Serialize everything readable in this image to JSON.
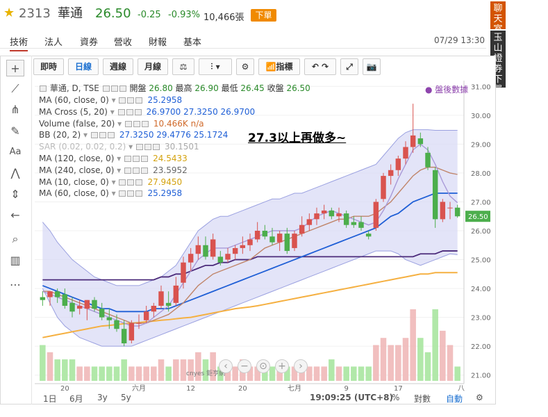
{
  "header": {
    "code": "2313",
    "name": "華通",
    "price": "26.50",
    "change": "-0.25",
    "change_pct": "-0.93%",
    "volume": "10,466張",
    "order_button": "下單"
  },
  "tabs": [
    "技術",
    "法人",
    "資券",
    "營收",
    "財報",
    "基本"
  ],
  "datetime": "07/29 13:30",
  "side_buttons": {
    "chat": "聊天室",
    "broker": "玉山證券下單"
  },
  "toolbar": {
    "periods": [
      "即時",
      "日線",
      "週線",
      "月線"
    ],
    "indicators": "指標"
  },
  "legend": {
    "main": {
      "label": "華通, D, TSE",
      "open_label": "開盤",
      "open": "26.80",
      "high_label": "最高",
      "high": "26.90",
      "low_label": "最低",
      "low": "26.45",
      "close_label": "收盤",
      "close": "26.50"
    },
    "rows": [
      {
        "label": "MA (60, close, 0)",
        "value": "25.2958"
      },
      {
        "label": "MA Cross (5, 20)",
        "value": "26.9700  27.3250  26.9700"
      },
      {
        "label": "Volume (false, 20)",
        "value": "10.466K  n/a"
      },
      {
        "label": "BB (20, 2)",
        "value": "27.3250  29.4776  25.1724"
      },
      {
        "label": "SAR (0.02, 0.02, 0.2)",
        "value": "30.1501"
      },
      {
        "label": "MA (120, close, 0)",
        "value": "24.5433"
      },
      {
        "label": "MA (240, close, 0)",
        "value": "23.5952"
      },
      {
        "label": "MA (10, close, 0)",
        "value": "27.9450"
      },
      {
        "label": "MA (60, close, 0)",
        "value": "25.2958"
      }
    ]
  },
  "post_market": "● 盤後數據",
  "annotation": "27.3以上再做多~",
  "colors": {
    "up": "#d9534f",
    "down": "#4cae4c",
    "bb_fill": "#d9dbf5",
    "ma_blue": "#1f5fd6",
    "ma_purple": "#4b2a7a",
    "ma_orange": "#f5b041",
    "ma_brown": "#c0856a",
    "last_price_bg": "#4cae4c"
  },
  "chart_data": {
    "type": "candlestick",
    "ylim": [
      20.8,
      31.2
    ],
    "y_ticks": [
      "31.00",
      "30.00",
      "29.00",
      "28.00",
      "27.00",
      "26.00",
      "25.00",
      "24.00",
      "23.00",
      "22.00",
      "21.00"
    ],
    "x_ticks": [
      "20",
      "六月",
      "12",
      "20",
      "七月",
      "9",
      "17",
      "八"
    ],
    "last_price_label": "26.50",
    "candles": [
      {
        "o": 23.7,
        "h": 23.9,
        "l": 23.4,
        "c": 23.6
      },
      {
        "o": 23.7,
        "h": 23.9,
        "l": 23.4,
        "c": 23.9
      },
      {
        "o": 23.9,
        "h": 24.0,
        "l": 23.5,
        "c": 23.7
      },
      {
        "o": 23.8,
        "h": 24.0,
        "l": 23.3,
        "c": 23.4
      },
      {
        "o": 23.5,
        "h": 23.7,
        "l": 23.0,
        "c": 23.2
      },
      {
        "o": 23.3,
        "h": 23.6,
        "l": 23.1,
        "c": 23.4
      },
      {
        "o": 23.3,
        "h": 23.6,
        "l": 22.9,
        "c": 23.6
      },
      {
        "o": 23.6,
        "h": 23.7,
        "l": 23.2,
        "c": 23.3
      },
      {
        "o": 23.3,
        "h": 23.5,
        "l": 22.9,
        "c": 23.0
      },
      {
        "o": 23.0,
        "h": 23.3,
        "l": 22.6,
        "c": 22.9
      },
      {
        "o": 22.9,
        "h": 23.1,
        "l": 22.5,
        "c": 22.6
      },
      {
        "o": 22.6,
        "h": 22.9,
        "l": 22.0,
        "c": 22.1
      },
      {
        "o": 22.2,
        "h": 22.9,
        "l": 22.1,
        "c": 22.8
      },
      {
        "o": 22.8,
        "h": 23.1,
        "l": 22.6,
        "c": 22.8
      },
      {
        "o": 22.9,
        "h": 23.4,
        "l": 22.8,
        "c": 23.2
      },
      {
        "o": 23.2,
        "h": 23.5,
        "l": 23.0,
        "c": 23.4
      },
      {
        "o": 23.4,
        "h": 24.1,
        "l": 23.3,
        "c": 23.9
      },
      {
        "o": 23.5,
        "h": 23.9,
        "l": 23.2,
        "c": 23.4
      },
      {
        "o": 23.5,
        "h": 24.4,
        "l": 23.4,
        "c": 24.1
      },
      {
        "o": 24.2,
        "h": 25.1,
        "l": 24.0,
        "c": 24.9
      },
      {
        "o": 24.9,
        "h": 25.4,
        "l": 24.6,
        "c": 25.2
      },
      {
        "o": 25.2,
        "h": 25.8,
        "l": 25.0,
        "c": 25.5
      },
      {
        "o": 25.5,
        "h": 25.8,
        "l": 25.0,
        "c": 25.1
      },
      {
        "o": 25.1,
        "h": 25.9,
        "l": 25.0,
        "c": 25.7
      },
      {
        "o": 25.1,
        "h": 25.3,
        "l": 24.8,
        "c": 24.9
      },
      {
        "o": 25.0,
        "h": 25.4,
        "l": 24.9,
        "c": 25.2
      },
      {
        "o": 25.2,
        "h": 25.5,
        "l": 25.0,
        "c": 25.4
      },
      {
        "o": 25.4,
        "h": 25.8,
        "l": 25.2,
        "c": 25.5
      },
      {
        "o": 25.5,
        "h": 25.9,
        "l": 25.3,
        "c": 25.7
      },
      {
        "o": 25.7,
        "h": 26.3,
        "l": 25.6,
        "c": 26.0
      },
      {
        "o": 26.0,
        "h": 26.2,
        "l": 25.7,
        "c": 25.8
      },
      {
        "o": 25.8,
        "h": 26.1,
        "l": 25.5,
        "c": 25.6
      },
      {
        "o": 25.6,
        "h": 26.0,
        "l": 25.3,
        "c": 25.9
      },
      {
        "o": 25.9,
        "h": 26.1,
        "l": 25.2,
        "c": 25.3
      },
      {
        "o": 25.4,
        "h": 26.0,
        "l": 25.3,
        "c": 25.9
      },
      {
        "o": 25.9,
        "h": 26.5,
        "l": 25.8,
        "c": 26.2
      },
      {
        "o": 26.2,
        "h": 26.6,
        "l": 26.0,
        "c": 26.4
      },
      {
        "o": 26.4,
        "h": 26.8,
        "l": 26.2,
        "c": 26.6
      },
      {
        "o": 26.6,
        "h": 26.9,
        "l": 26.4,
        "c": 26.7
      },
      {
        "o": 26.7,
        "h": 26.8,
        "l": 26.4,
        "c": 26.5
      },
      {
        "o": 26.5,
        "h": 26.8,
        "l": 26.3,
        "c": 26.6
      },
      {
        "o": 26.6,
        "h": 26.7,
        "l": 26.1,
        "c": 26.2
      },
      {
        "o": 26.3,
        "h": 26.5,
        "l": 26.1,
        "c": 26.2
      },
      {
        "o": 26.3,
        "h": 26.5,
        "l": 26.0,
        "c": 26.1
      },
      {
        "o": 25.9,
        "h": 26.0,
        "l": 25.7,
        "c": 25.8
      },
      {
        "o": 26.1,
        "h": 27.1,
        "l": 26.0,
        "c": 27.0
      },
      {
        "o": 27.1,
        "h": 28.0,
        "l": 27.0,
        "c": 27.9
      },
      {
        "o": 27.9,
        "h": 28.3,
        "l": 27.6,
        "c": 28.1
      },
      {
        "o": 28.1,
        "h": 28.6,
        "l": 27.9,
        "c": 28.5
      },
      {
        "o": 28.5,
        "h": 29.1,
        "l": 28.3,
        "c": 28.9
      },
      {
        "o": 28.9,
        "h": 30.4,
        "l": 28.7,
        "c": 29.3
      },
      {
        "o": 29.2,
        "h": 29.4,
        "l": 28.9,
        "c": 29.0
      },
      {
        "o": 28.7,
        "h": 28.9,
        "l": 28.1,
        "c": 28.2
      },
      {
        "o": 28.1,
        "h": 28.2,
        "l": 26.1,
        "c": 26.4
      },
      {
        "o": 26.4,
        "h": 27.1,
        "l": 26.3,
        "c": 27.0
      },
      {
        "o": 26.8,
        "h": 27.0,
        "l": 26.4,
        "c": 26.8
      },
      {
        "o": 26.8,
        "h": 26.9,
        "l": 26.45,
        "c": 26.5
      }
    ],
    "volumes": [
      5,
      4,
      3,
      3,
      3,
      2,
      2,
      2,
      2,
      2,
      2,
      3,
      2,
      2,
      2,
      2,
      3,
      2,
      3,
      3,
      3,
      4,
      3,
      4,
      2,
      2,
      2,
      3,
      2,
      2,
      2,
      2,
      2,
      2,
      2,
      2,
      2,
      2,
      2,
      3,
      2,
      2,
      2,
      2,
      2,
      5,
      6,
      5,
      5,
      6,
      10,
      6,
      4,
      10,
      7,
      5,
      2
    ],
    "ma_blue": [
      24.1,
      24.0,
      23.9,
      23.8,
      23.7,
      23.6,
      23.5,
      23.4,
      23.3,
      23.3,
      23.2,
      23.2,
      23.2,
      23.2,
      23.2,
      23.3,
      23.3,
      23.3,
      23.4,
      23.5,
      23.6,
      23.7,
      23.8,
      23.9,
      24.0,
      24.1,
      24.2,
      24.3,
      24.4,
      24.5,
      24.6,
      24.7,
      24.8,
      24.9,
      25.0,
      25.1,
      25.2,
      25.3,
      25.4,
      25.5,
      25.6,
      25.7,
      25.8,
      25.9,
      26.0,
      26.1,
      26.3,
      26.5,
      26.6,
      26.8,
      27.0,
      27.1,
      27.2,
      27.3,
      27.3,
      27.3,
      27.3
    ],
    "ma_purple": [
      24.3,
      24.3,
      24.3,
      24.3,
      24.3,
      24.3,
      24.3,
      24.3,
      24.3,
      24.3,
      24.3,
      24.3,
      24.3,
      24.3,
      24.3,
      24.3,
      24.4,
      24.4,
      24.5,
      24.5,
      24.6,
      24.7,
      24.8,
      24.8,
      24.9,
      24.9,
      25.0,
      25.0,
      25.0,
      25.1,
      25.1,
      25.1,
      25.1,
      25.1,
      25.1,
      25.1,
      25.1,
      25.1,
      25.1,
      25.1,
      25.1,
      25.1,
      25.1,
      25.1,
      25.1,
      25.1,
      25.1,
      25.1,
      25.1,
      25.1,
      25.1,
      25.2,
      25.2,
      25.2,
      25.3,
      25.3,
      25.3
    ],
    "ma_orange": [
      22.3,
      22.35,
      22.4,
      22.45,
      22.5,
      22.55,
      22.6,
      22.65,
      22.7,
      22.72,
      22.75,
      22.78,
      22.8,
      22.82,
      22.85,
      22.87,
      22.9,
      22.92,
      22.95,
      22.98,
      23.0,
      23.05,
      23.1,
      23.15,
      23.2,
      23.25,
      23.3,
      23.33,
      23.36,
      23.4,
      23.45,
      23.5,
      23.55,
      23.6,
      23.65,
      23.7,
      23.75,
      23.8,
      23.85,
      23.9,
      23.95,
      24.0,
      24.05,
      24.1,
      24.15,
      24.2,
      24.25,
      24.3,
      24.35,
      24.4,
      24.45,
      24.5,
      24.5,
      24.55,
      24.55,
      24.55,
      24.55
    ],
    "ma_brown": [
      23.9,
      23.9,
      23.8,
      23.7,
      23.6,
      23.5,
      23.4,
      23.3,
      23.2,
      23.1,
      23.0,
      22.9,
      22.8,
      22.8,
      22.8,
      22.9,
      23.0,
      23.1,
      23.3,
      23.5,
      23.8,
      24.1,
      24.3,
      24.5,
      24.6,
      24.7,
      24.8,
      24.9,
      25.0,
      25.2,
      25.4,
      25.5,
      25.6,
      25.7,
      25.8,
      25.9,
      26.0,
      26.1,
      26.2,
      26.3,
      26.4,
      26.4,
      26.5,
      26.5,
      26.5,
      26.6,
      26.8,
      27.0,
      27.3,
      27.6,
      27.9,
      28.1,
      28.2,
      28.2,
      28.1,
      28.0,
      27.95
    ],
    "ma_lavender": [
      23.9,
      23.8,
      23.7,
      23.6,
      23.5,
      23.4,
      23.3,
      23.2,
      23.1,
      23.0,
      22.9,
      22.8,
      22.7,
      22.7,
      22.8,
      23.0,
      23.2,
      23.4,
      23.8,
      24.2,
      24.6,
      25.0,
      25.2,
      25.4,
      25.4,
      25.4,
      25.5,
      25.6,
      25.7,
      25.8,
      25.9,
      26.0,
      26.0,
      26.0,
      26.0,
      26.1,
      26.3,
      26.5,
      26.6,
      26.7,
      26.6,
      26.5,
      26.4,
      26.3,
      26.2,
      26.3,
      26.7,
      27.2,
      27.8,
      28.3,
      28.8,
      29.0,
      28.8,
      28.3,
      27.7,
      27.2,
      26.97
    ],
    "bb_upper": [
      26.3,
      26.0,
      25.6,
      25.3,
      25.0,
      24.8,
      24.6,
      24.4,
      24.3,
      24.2,
      24.1,
      24.1,
      24.1,
      24.1,
      24.2,
      24.3,
      24.4,
      24.6,
      24.8,
      25.2,
      25.6,
      26.0,
      26.2,
      26.4,
      26.5,
      26.5,
      26.6,
      26.7,
      26.8,
      26.9,
      27.0,
      27.1,
      27.1,
      27.2,
      27.3,
      27.3,
      27.4,
      27.5,
      27.6,
      27.7,
      27.8,
      27.9,
      28.0,
      28.1,
      28.2,
      28.3,
      28.6,
      28.9,
      29.2,
      29.4,
      29.5,
      29.5,
      29.5,
      29.48,
      29.48,
      29.48,
      29.48
    ],
    "bb_lower": [
      24.0,
      23.5,
      23.0,
      22.7,
      22.5,
      22.3,
      22.2,
      22.1,
      22.0,
      22.0,
      22.0,
      22.0,
      22.0,
      22.1,
      22.2,
      22.3,
      22.4,
      22.5,
      22.6,
      22.7,
      22.8,
      22.9,
      23.0,
      23.1,
      23.2,
      23.3,
      23.4,
      23.5,
      23.6,
      23.7,
      23.8,
      23.9,
      24.0,
      24.1,
      24.2,
      24.3,
      24.4,
      24.5,
      24.6,
      24.7,
      24.8,
      24.9,
      25.0,
      25.1,
      25.2,
      25.3,
      25.3,
      25.3,
      25.2,
      25.0,
      24.9,
      24.8,
      24.9,
      25.0,
      25.1,
      25.2,
      25.17
    ]
  },
  "bottom": {
    "ranges": [
      "1日",
      "6月",
      "3y",
      "5y"
    ],
    "time": "19:09:25 (UTC+8)",
    "pct": "%",
    "log": "對數",
    "auto": "自動"
  },
  "watermark": "cnyes 鉅亨網"
}
